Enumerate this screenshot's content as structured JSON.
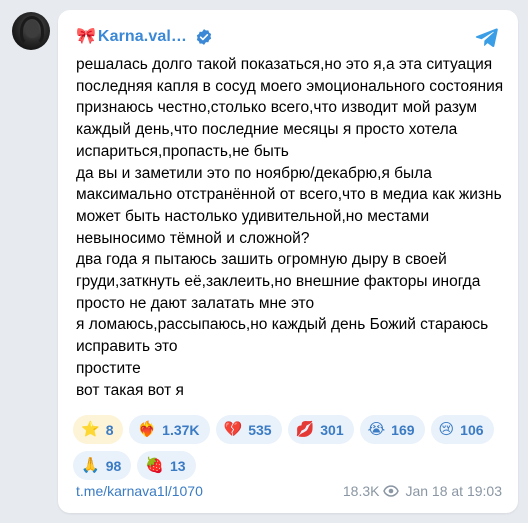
{
  "channel": {
    "ribbon_emoji": "🎀",
    "name": "Karna.val…"
  },
  "post": {
    "text": "решалась долго такой показаться,но это я,а эта ситуация последняя капля в сосуд моего эмоционального состояния\nпризнаюсь честно,столько всего,что изводит мой разум каждый день,что последние месяцы я просто хотела испариться,пропасть,не быть\nда вы и заметили это по ноябрю/декабрю,я была максимально отстранённой от всего,что в медиа как жизнь может быть настолько удивительной,но местами невыносимо тёмной и сложной?\nдва года я пытаюсь зашить огромную дыру в своей груди,заткнуть её,заклеить,но внешние факторы иногда просто не дают залатать мне это\nя ломаюсь,рассыпаюсь,но каждый день Божий стараюсь исправить это\nпростите\nвот такая вот я"
  },
  "reactions": [
    {
      "emoji": "⭐",
      "count": "8"
    },
    {
      "emoji": "❤️‍🔥",
      "count": "1.37K"
    },
    {
      "emoji": "💔",
      "count": "535"
    },
    {
      "emoji": "💋",
      "count": "301"
    },
    {
      "emoji": "😭",
      "count": "169"
    },
    {
      "emoji": "😢",
      "count": "106"
    },
    {
      "emoji": "🙏",
      "count": "98"
    },
    {
      "emoji": "🍓",
      "count": "13"
    }
  ],
  "footer": {
    "link": "t.me/karnava1l/1070",
    "views": "18.3K",
    "date": "Jan 18 at 19:03"
  },
  "colors": {
    "accent": "#3a88d6",
    "background": "#e7ebf0",
    "reaction_bg": "#e9f1fb",
    "star_bg": "#fdf3d7"
  }
}
